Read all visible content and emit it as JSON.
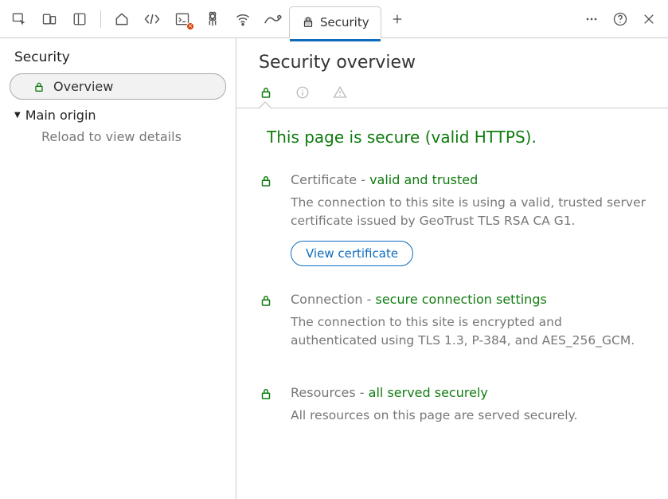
{
  "toolbar": {
    "securityTab": "Security",
    "mainTools": [
      "inspect",
      "device",
      "dock",
      "home",
      "elements",
      "console",
      "app",
      "network",
      "more-arrows"
    ],
    "rightTools": [
      "add",
      "dots",
      "help",
      "close"
    ]
  },
  "sidebar": {
    "title": "Security",
    "overview_label": "Overview",
    "main_origin_label": "Main origin",
    "reload_label": "Reload to view details"
  },
  "content": {
    "heading": "Security overview",
    "headline": "This page is secure (valid HTTPS).",
    "cert_section": {
      "label": "Certificate - ",
      "status": "valid and trusted",
      "desc": "The connection to this site is using a valid, trusted server certificate issued by GeoTrust TLS RSA CA G1.",
      "button": "View certificate"
    },
    "conn_section": {
      "label": "Connection - ",
      "status": "secure connection settings",
      "desc": "The connection to this site is encrypted and authenticated using TLS 1.3, P-384, and AES_256_GCM."
    },
    "res_section": {
      "label": "Resources - ",
      "status": "all served securely",
      "desc": "All resources on this page are served securely."
    }
  }
}
